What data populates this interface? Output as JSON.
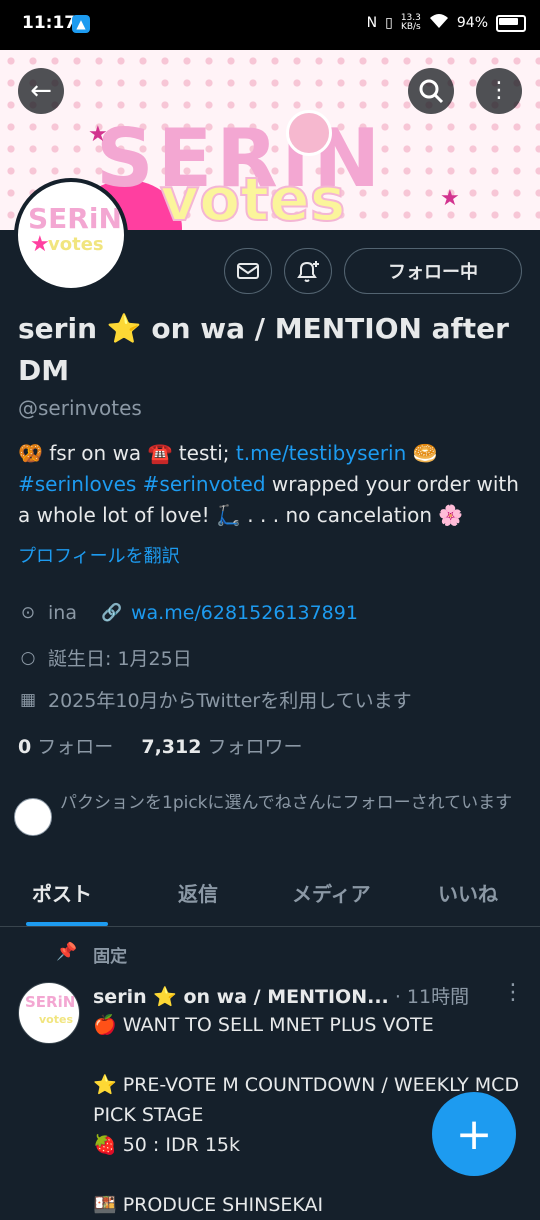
{
  "status_bar": {
    "time": "11:17",
    "network_speed": "13.3",
    "network_unit": "KB/s",
    "battery": "94%"
  },
  "profile": {
    "name": "serin ⭐ on wa / MENTION after DM",
    "handle": "@serinvotes",
    "follow_button": "フォロー中",
    "bio": {
      "p1": "🥨 fsr on wa ☎️ testi; ",
      "link1": "t.me/testibyserin",
      "p2": " 🥯 ",
      "hashtag1": "#serinloves",
      "p3": " ",
      "hashtag2": "#serinvoted",
      "p4": " wrapped your order with a whole lot of love! 🛴 . . . no cancelation 🌸"
    },
    "translate_label": "プロフィールを翻訳",
    "location": "ina",
    "website": "wa.me/6281526137891",
    "birthday": "誕生日: 1月25日",
    "joined": "2025年10月からTwitterを利用しています",
    "following_count": "0",
    "following_label": "フォロー",
    "followers_count": "7,312",
    "followers_label": "フォロワー",
    "followed_by": "パクションを1pickに選んでねさんにフォローされています"
  },
  "tabs": [
    {
      "label": "ポスト",
      "active": true
    },
    {
      "label": "返信",
      "active": false
    },
    {
      "label": "メディア",
      "active": false
    },
    {
      "label": "いいね",
      "active": false
    }
  ],
  "pinned_post": {
    "pinned_label": "固定",
    "author": "serin ⭐ on wa / MENTION...",
    "time": "· 11時間",
    "lines": [
      "🍎 WANT TO SELL MNET PLUS VOTE",
      "",
      "⭐ PRE-VOTE M COUNTDOWN / WEEKLY MCD PICK STAGE",
      "🍓 50 : IDR 15k",
      "",
      "🍱 PRODUCE SHINSEKAI"
    ]
  },
  "colors": {
    "background": "#15202b",
    "accent": "#1d9bf0",
    "muted_text": "#8b98a5"
  }
}
